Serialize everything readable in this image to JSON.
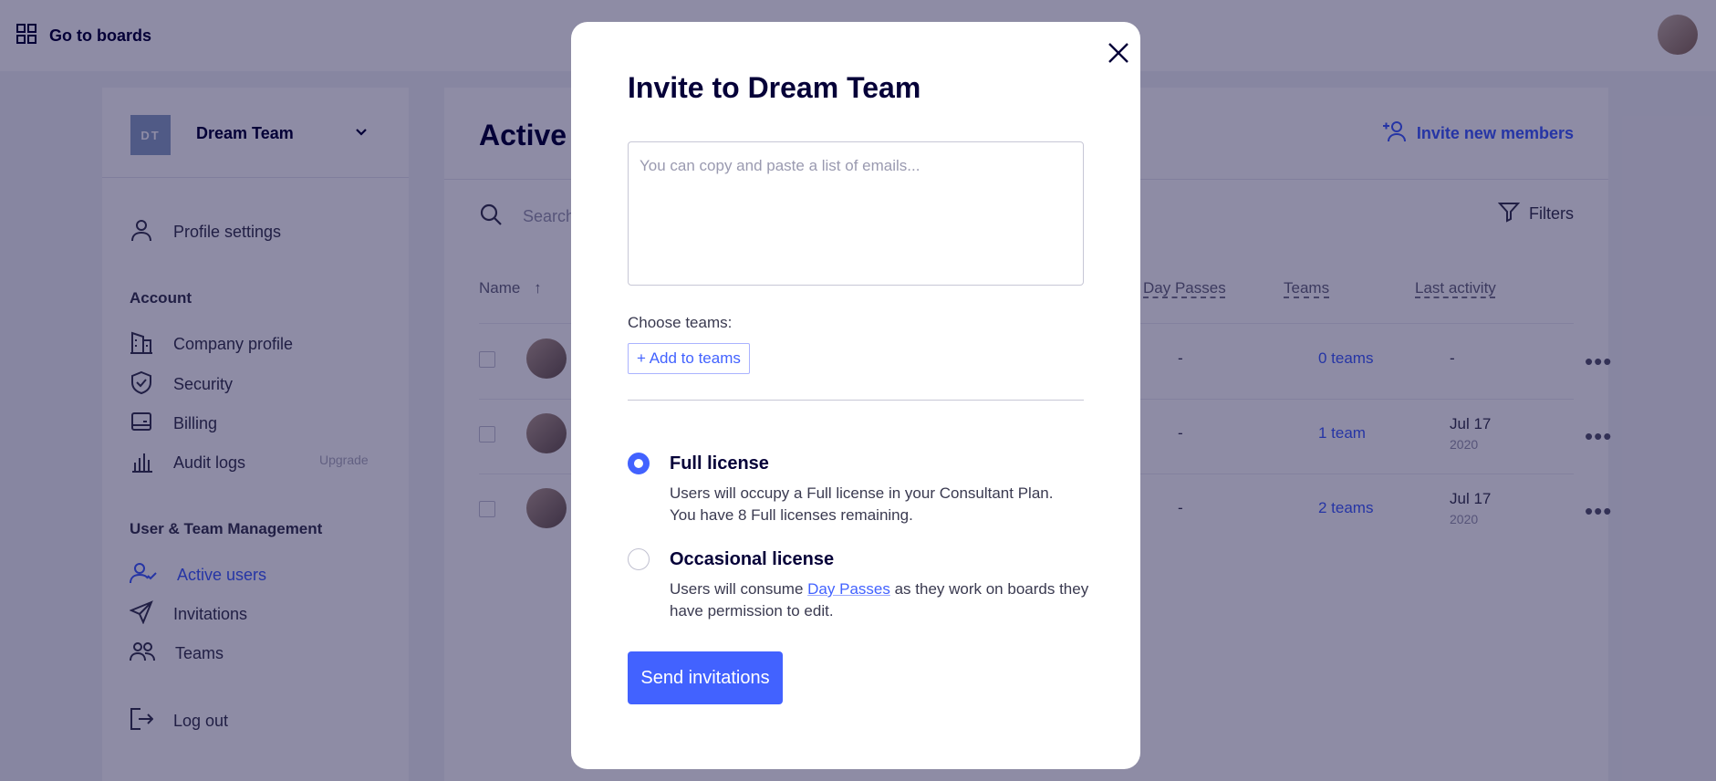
{
  "topbar": {
    "go_to_boards": "Go to boards"
  },
  "sidebar": {
    "team_initials": "DT",
    "team_name": "Dream Team",
    "profile_settings": "Profile settings",
    "account_heading": "Account",
    "account_items": [
      "Company profile",
      "Security",
      "Billing",
      "Audit logs"
    ],
    "upgrade": "Upgrade",
    "management_heading": "User & Team Management",
    "management_items": [
      "Active users",
      "Invitations",
      "Teams"
    ],
    "log_out": "Log out"
  },
  "main": {
    "title": "Active users",
    "invite_new": "Invite new members",
    "search_placeholder": "Search",
    "filters": "Filters",
    "columns": {
      "name": "Name",
      "day_passes": "Day Passes",
      "teams": "Teams",
      "last_activity": "Last activity"
    },
    "rows": [
      {
        "day_passes": "-",
        "teams": "0 teams",
        "last_activity": "-",
        "year": ""
      },
      {
        "day_passes": "-",
        "teams": "1 team",
        "last_activity": "Jul 17",
        "year": "2020"
      },
      {
        "day_passes": "-",
        "teams": "2 teams",
        "last_activity": "Jul 17",
        "year": "2020"
      }
    ]
  },
  "modal": {
    "title": "Invite to Dream Team",
    "email_placeholder": "You can copy and paste a list of emails...",
    "choose_teams": "Choose teams:",
    "add_to_teams": "+ Add to teams",
    "full_license": {
      "title": "Full license",
      "line1": "Users will occupy a Full license in your Consultant Plan.",
      "line2": "You have 8 Full licenses remaining.",
      "selected": true
    },
    "occasional_license": {
      "title": "Occasional license",
      "desc_before": "Users will consume ",
      "link": "Day Passes",
      "desc_after": " as they work on boards they have permission to edit.",
      "selected": false
    },
    "send": "Send invitations"
  },
  "colors": {
    "accent": "#4262ff",
    "ink": "#050038",
    "overlay": "rgba(5,0,56,0.45)"
  }
}
